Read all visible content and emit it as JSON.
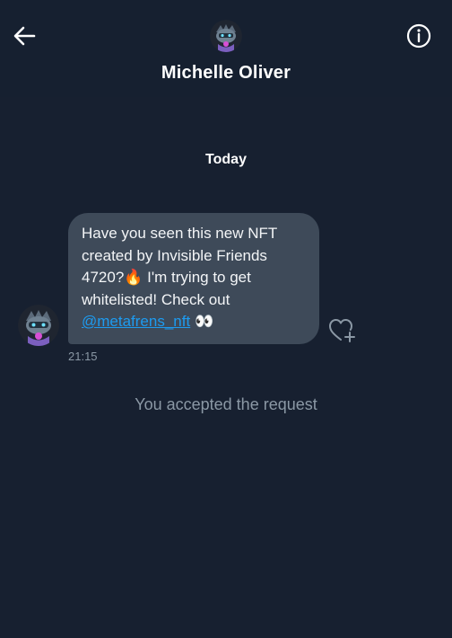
{
  "header": {
    "back_icon": "arrow-left-icon",
    "title": "Michelle Oliver",
    "info_icon": "info-circle-icon"
  },
  "conversation": {
    "date_separator": "Today",
    "message": {
      "lines": [
        "Have you seen this new NFT",
        "created by Invisible Friends",
        "4720?",
        " I'm trying to get",
        "whitelisted! Check out"
      ],
      "emoji_fire": "🔥",
      "mention": "@metafrens_nft",
      "emoji_eyes": "👀",
      "timestamp": "21:15",
      "react_icon": "heart-plus-icon"
    },
    "system_message": "You accepted the request"
  },
  "colors": {
    "background": "#172030",
    "bubble": "#3e4a59",
    "link": "#1d9bf0",
    "muted_text": "#8b98a5"
  }
}
